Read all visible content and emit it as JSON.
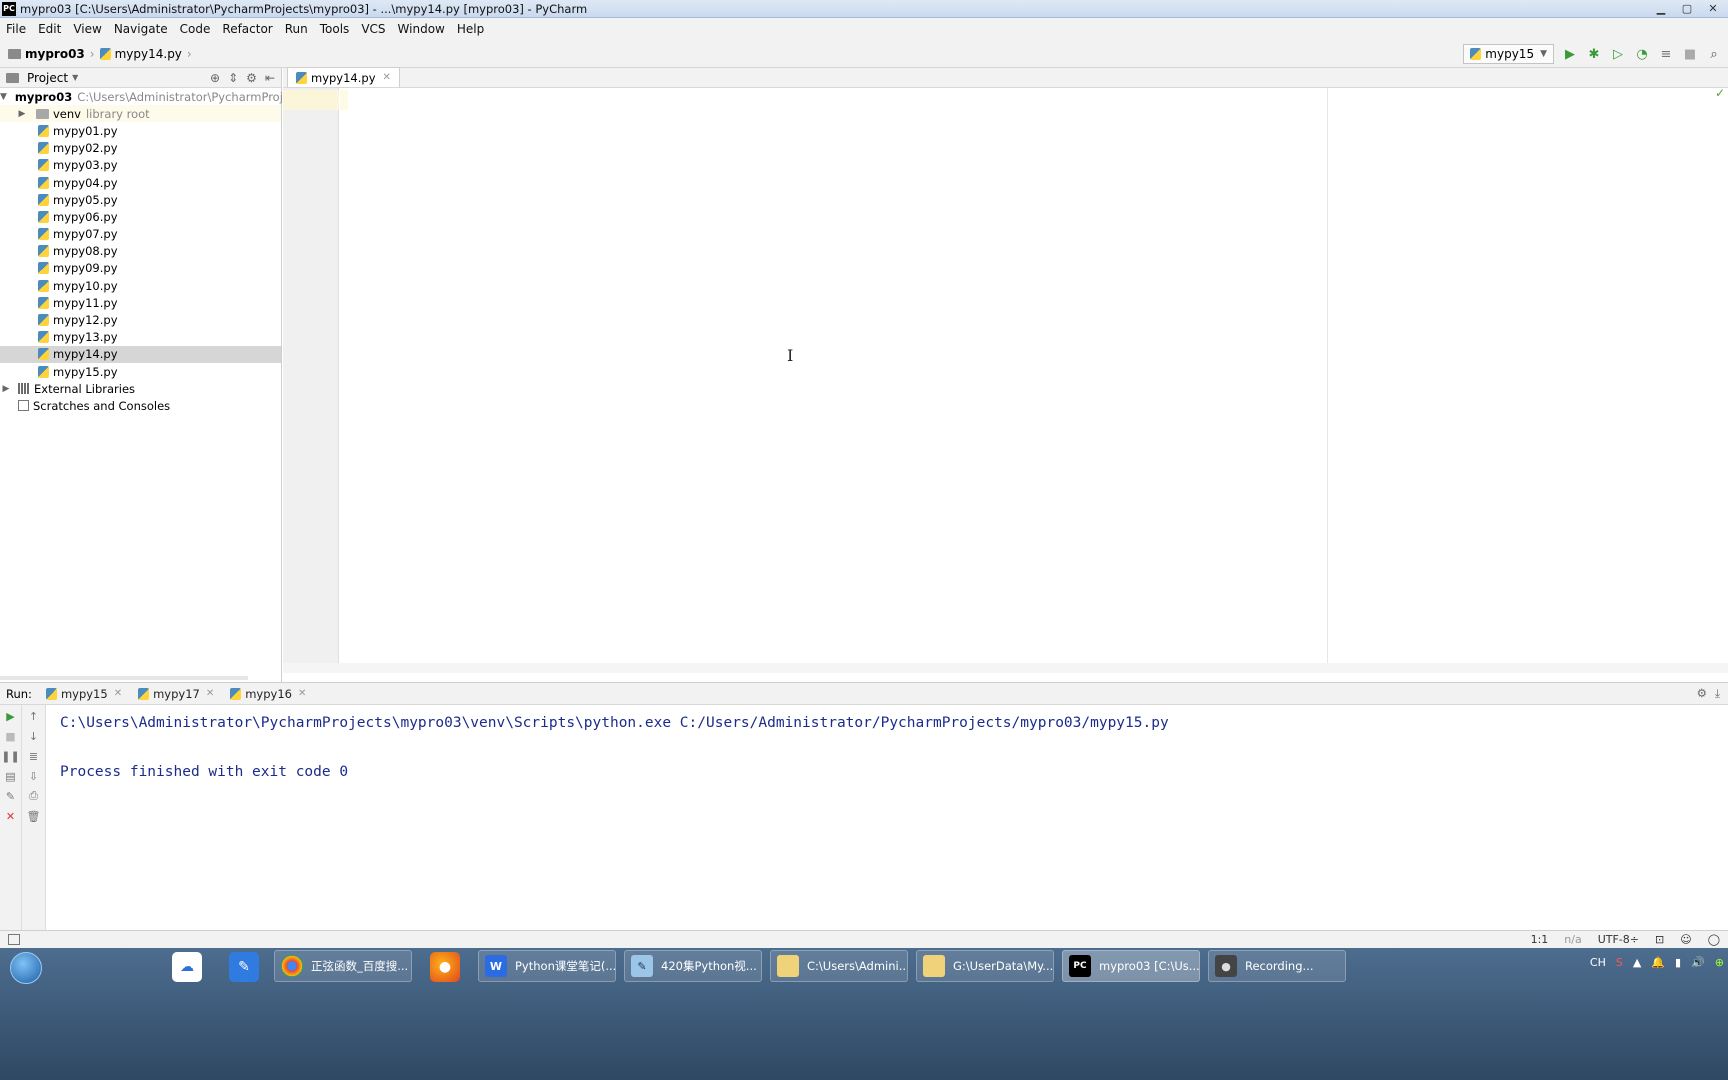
{
  "window": {
    "title": "mypro03 [C:\\Users\\Administrator\\PycharmProjects\\mypro03] - ...\\mypy14.py [mypro03] - PyCharm",
    "app_icon": "PC"
  },
  "menu": [
    "File",
    "Edit",
    "View",
    "Navigate",
    "Code",
    "Refactor",
    "Run",
    "Tools",
    "VCS",
    "Window",
    "Help"
  ],
  "breadcrumb": {
    "project": "mypro03",
    "file": "mypy14.py"
  },
  "run_config": {
    "label": "mypy15"
  },
  "project_panel": {
    "title": "Project",
    "root": {
      "name": "mypro03",
      "path": "C:\\Users\\Administrator\\PycharmProjects\\m"
    },
    "venv": {
      "name": "venv",
      "note": "library root"
    },
    "files": [
      "mypy01.py",
      "mypy02.py",
      "mypy03.py",
      "mypy04.py",
      "mypy05.py",
      "mypy06.py",
      "mypy07.py",
      "mypy08.py",
      "mypy09.py",
      "mypy10.py",
      "mypy11.py",
      "mypy12.py",
      "mypy13.py",
      "mypy14.py",
      "mypy15.py"
    ],
    "selected_file": "mypy14.py",
    "external_libraries": "External Libraries",
    "scratches": "Scratches and Consoles"
  },
  "editor": {
    "tab_label": "mypy14.py"
  },
  "run_panel": {
    "label": "Run:",
    "tabs": [
      "mypy15",
      "mypy17",
      "mypy16"
    ],
    "console_lines": [
      "C:\\Users\\Administrator\\PycharmProjects\\mypro03\\venv\\Scripts\\python.exe C:/Users/Administrator/PycharmProjects/mypro03/mypy15.py",
      "",
      "Process finished with exit code 0"
    ]
  },
  "statusbar": {
    "position": "1:1",
    "na": "n/a",
    "encoding": "UTF-8÷"
  },
  "taskbar": {
    "tasks": [
      {
        "label": "正弦函数_百度搜...",
        "icon": "chrome-icon"
      },
      {
        "label": "Python课堂笔记(...",
        "icon": "wps-writer-icon"
      },
      {
        "label": "420集Python视...",
        "icon": "notepad-icon"
      },
      {
        "label": "C:\\Users\\Admini...",
        "icon": "folder-icon"
      },
      {
        "label": "G:\\UserData\\My...",
        "icon": "folder-icon"
      },
      {
        "label": "mypro03 [C:\\Us...",
        "icon": "pycharm-icon"
      },
      {
        "label": "Recording...",
        "icon": "recorder-icon"
      }
    ],
    "tray_lang": "CH"
  }
}
